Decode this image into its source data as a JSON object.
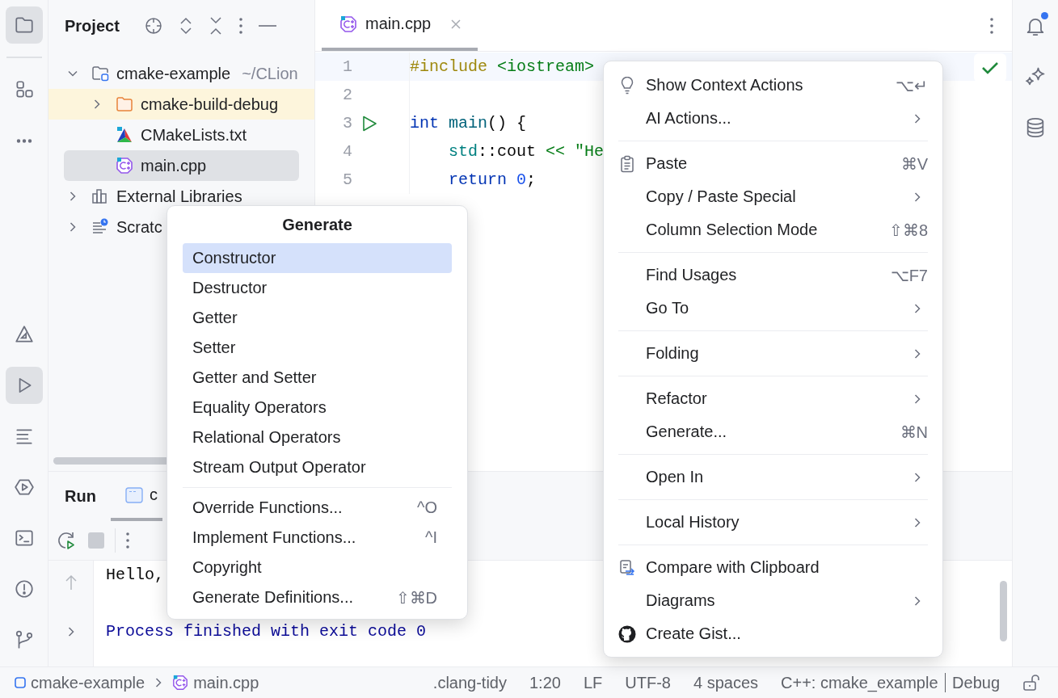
{
  "left_toolbar": {
    "top": [
      {
        "kind": "folder",
        "selected": true
      },
      {
        "kind": "structure",
        "selected": false
      },
      {
        "kind": "more",
        "selected": false
      }
    ],
    "bottom": [
      {
        "kind": "cmake",
        "selected": false
      },
      {
        "kind": "run",
        "selected": true
      },
      {
        "kind": "list",
        "selected": false
      },
      {
        "kind": "services",
        "selected": false
      },
      {
        "kind": "terminal",
        "selected": false
      },
      {
        "kind": "problems",
        "selected": false
      },
      {
        "kind": "git",
        "selected": false
      }
    ]
  },
  "project_panel": {
    "title": "Project",
    "tree": [
      {
        "label": "cmake-example",
        "path": "~/CLion",
        "kind": "module",
        "expanded": true,
        "selected": false,
        "excluded": false,
        "children": [
          {
            "label": "cmake-build-debug",
            "kind": "folder",
            "expanded": false,
            "selected": false,
            "excluded": true
          },
          {
            "label": "CMakeLists.txt",
            "kind": "cmake",
            "selected": false,
            "excluded": false
          },
          {
            "label": "main.cpp",
            "kind": "cpp",
            "selected": true,
            "excluded": false
          }
        ]
      },
      {
        "label": "External Libraries",
        "kind": "libraries",
        "expanded": false,
        "selected": false,
        "excluded": false
      },
      {
        "label": "Scratc",
        "kind": "scratches",
        "expanded": false,
        "selected": false,
        "excluded": false
      }
    ]
  },
  "editor": {
    "tabs": [
      {
        "label": "main.cpp",
        "kind": "cpp",
        "selected": true
      }
    ],
    "lines": [
      {
        "number": "1",
        "current": true,
        "runnable": false,
        "tokens": [
          {
            "text": "#include",
            "kind": "directive"
          },
          {
            "text": " <iostream>",
            "kind": "header"
          }
        ]
      },
      {
        "number": "2",
        "current": false,
        "runnable": false
      },
      {
        "number": "3",
        "current": false,
        "runnable": true,
        "tokens": [
          {
            "text": "int",
            "kind": "keyword"
          },
          {
            "text": " main",
            "kind": "function"
          },
          {
            "text": "() {",
            "kind": "plain"
          }
        ]
      },
      {
        "number": "4",
        "current": false,
        "runnable": false,
        "tokens": [
          {
            "text": "    std",
            "kind": "namespace"
          },
          {
            "text": "::cout ",
            "kind": "plain"
          },
          {
            "text": "<<",
            "kind": "operator"
          },
          {
            "text": " \"He",
            "kind": "string"
          }
        ]
      },
      {
        "number": "5",
        "current": false,
        "runnable": false,
        "tokens": [
          {
            "text": "    return",
            "kind": "keyword"
          },
          {
            "text": " 0",
            "kind": "number"
          },
          {
            "text": ";",
            "kind": "plain"
          }
        ]
      }
    ]
  },
  "run_panel": {
    "title": "Run",
    "tabs": [
      {
        "label": "c",
        "selected": true
      }
    ],
    "output": [
      {
        "text": "Hello,",
        "kind": "stdout"
      },
      {
        "text": "Process finished with exit code 0",
        "kind": "system"
      }
    ]
  },
  "right_toolbar": [
    {
      "kind": "notifications",
      "badge": true
    },
    {
      "kind": "ai",
      "badge": false
    },
    {
      "kind": "database",
      "badge": false
    }
  ],
  "generate_menu": {
    "title": "Generate",
    "groups": [
      [
        {
          "label": "Constructor",
          "selected": true
        },
        {
          "label": "Destructor",
          "selected": false
        },
        {
          "label": "Getter",
          "selected": false
        },
        {
          "label": "Setter",
          "selected": false
        },
        {
          "label": "Getter and Setter",
          "selected": false
        },
        {
          "label": "Equality Operators",
          "selected": false
        },
        {
          "label": "Relational Operators",
          "selected": false
        },
        {
          "label": "Stream Output Operator",
          "selected": false
        }
      ],
      [
        {
          "label": "Override Functions...",
          "shortcut": "^O",
          "selected": false
        },
        {
          "label": "Implement Functions...",
          "shortcut": "^I",
          "selected": false
        },
        {
          "label": "Copyright",
          "selected": false
        },
        {
          "label": "Generate Definitions...",
          "shortcut": "⇧⌘D",
          "selected": false
        }
      ]
    ]
  },
  "context_menu": {
    "groups": [
      [
        {
          "label": "Show Context Actions",
          "kind": "bulb",
          "shortcut": "⌥↵",
          "submenu": false
        },
        {
          "label": "AI Actions...",
          "kind": "plain",
          "submenu": true
        }
      ],
      [
        {
          "label": "Paste",
          "kind": "clipboard",
          "shortcut": "⌘V",
          "submenu": false
        },
        {
          "label": "Copy / Paste Special",
          "kind": "plain",
          "submenu": true
        },
        {
          "label": "Column Selection Mode",
          "kind": "plain",
          "shortcut": "⇧⌘8",
          "submenu": false
        }
      ],
      [
        {
          "label": "Find Usages",
          "kind": "plain",
          "shortcut": "⌥F7",
          "submenu": false
        },
        {
          "label": "Go To",
          "kind": "plain",
          "submenu": true
        }
      ],
      [
        {
          "label": "Folding",
          "kind": "plain",
          "submenu": true
        }
      ],
      [
        {
          "label": "Refactor",
          "kind": "plain",
          "submenu": true
        },
        {
          "label": "Generate...",
          "kind": "plain",
          "shortcut": "⌘N",
          "submenu": false
        }
      ],
      [
        {
          "label": "Open In",
          "kind": "plain",
          "submenu": true
        }
      ],
      [
        {
          "label": "Local History",
          "kind": "plain",
          "submenu": true
        }
      ],
      [
        {
          "label": "Compare with Clipboard",
          "kind": "compare",
          "submenu": false
        },
        {
          "label": "Diagrams",
          "kind": "plain",
          "submenu": true
        },
        {
          "label": "Create Gist...",
          "kind": "github",
          "submenu": false
        }
      ]
    ]
  },
  "status_bar": {
    "breadcrumbs": [
      {
        "label": "cmake-example",
        "kind": "module"
      },
      {
        "label": "main.cpp",
        "kind": "cpp"
      }
    ],
    "items": [
      ".clang-tidy",
      "1:20",
      "LF",
      "UTF-8",
      "4 spaces"
    ],
    "language": "C++: cmake_example",
    "configuration": "Debug"
  }
}
